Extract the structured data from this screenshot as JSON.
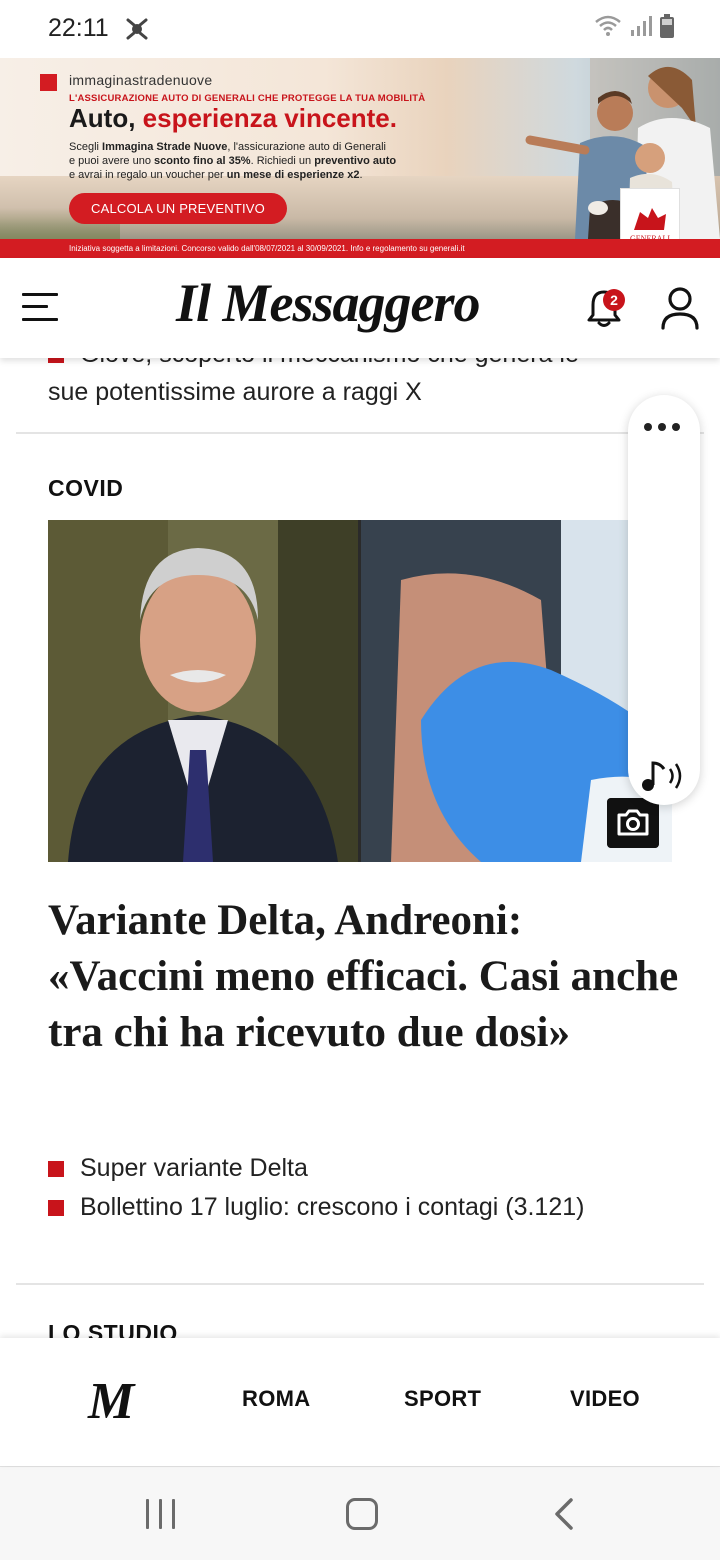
{
  "status_bar": {
    "time": "22:11"
  },
  "ad": {
    "brand": "immaginastradenuove",
    "tagline": "L'ASSICURAZIONE AUTO DI GENERALI CHE PROTEGGE LA TUA MOBILITÀ",
    "headline_part1": "Auto,",
    "headline_part2": "esperienza vincente.",
    "body_1": "Scegli ",
    "body_2": "Immagina Strade Nuove",
    "body_3": ", l'assicurazione auto di Generali",
    "body_4": "e puoi avere uno ",
    "body_5": "sconto fino al 35%",
    "body_6": ". Richiedi un ",
    "body_7": "preventivo auto",
    "body_8": "e avrai in regalo un voucher per ",
    "body_9": "un mese di esperienze x2",
    "body_10": ".",
    "cta": "CALCOLA UN PREVENTIVO",
    "footer": "Iniziativa soggetta a limitazioni. Concorso valido dall'08/07/2021 al 30/09/2021. Info e regolamento su generali.it",
    "logo_text": "GENERALI"
  },
  "header": {
    "logo": "Il Messaggero",
    "notification_count": "2"
  },
  "previous_item": {
    "cut_text": "Giove, scoperto il meccanismo che genera le",
    "line2": "sue potentissime aurore a raggi X"
  },
  "article": {
    "section": "COVID",
    "headline": "Variante Delta, Andreoni: «Vaccini meno efficaci. Casi anche tra chi ha ricevuto due dosi»",
    "related": [
      "Super variante Delta",
      "Bollettino 17 luglio: crescono i contagi (3.121)"
    ]
  },
  "next_section": {
    "label": "LO STUDIO"
  },
  "bottom_nav": {
    "logo": "M",
    "items": [
      "ROMA",
      "SPORT",
      "VIDEO"
    ]
  },
  "colors": {
    "brand_red": "#c8141b",
    "text_dark": "#1a1a1a"
  }
}
